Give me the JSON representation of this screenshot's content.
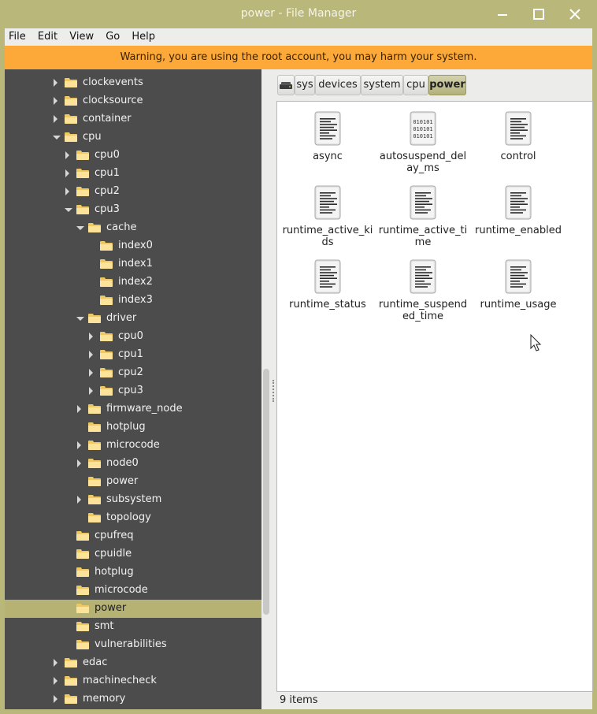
{
  "window": {
    "title": "power - File Manager",
    "controls": [
      "minimize-icon",
      "maximize-icon",
      "close-icon"
    ]
  },
  "menu": {
    "items": [
      "File",
      "Edit",
      "View",
      "Go",
      "Help"
    ]
  },
  "warning": {
    "text": "Warning, you are using the root account, you may harm your system."
  },
  "colors": {
    "titlebar": "#b9b77a",
    "warning_bg": "#fca93a",
    "sidebar_bg": "#4c4c4c",
    "selection": "#b5b273"
  },
  "tree": {
    "items": [
      {
        "label": "clockevents",
        "depth": 0,
        "expander": "closed"
      },
      {
        "label": "clocksource",
        "depth": 0,
        "expander": "closed"
      },
      {
        "label": "container",
        "depth": 0,
        "expander": "closed"
      },
      {
        "label": "cpu",
        "depth": 0,
        "expander": "open"
      },
      {
        "label": "cpu0",
        "depth": 1,
        "expander": "closed"
      },
      {
        "label": "cpu1",
        "depth": 1,
        "expander": "closed"
      },
      {
        "label": "cpu2",
        "depth": 1,
        "expander": "closed"
      },
      {
        "label": "cpu3",
        "depth": 1,
        "expander": "open"
      },
      {
        "label": "cache",
        "depth": 2,
        "expander": "open"
      },
      {
        "label": "index0",
        "depth": 3,
        "expander": "none"
      },
      {
        "label": "index1",
        "depth": 3,
        "expander": "none"
      },
      {
        "label": "index2",
        "depth": 3,
        "expander": "none"
      },
      {
        "label": "index3",
        "depth": 3,
        "expander": "none"
      },
      {
        "label": "driver",
        "depth": 2,
        "expander": "open"
      },
      {
        "label": "cpu0",
        "depth": 3,
        "expander": "closed"
      },
      {
        "label": "cpu1",
        "depth": 3,
        "expander": "closed"
      },
      {
        "label": "cpu2",
        "depth": 3,
        "expander": "closed"
      },
      {
        "label": "cpu3",
        "depth": 3,
        "expander": "closed"
      },
      {
        "label": "firmware_node",
        "depth": 2,
        "expander": "closed"
      },
      {
        "label": "hotplug",
        "depth": 2,
        "expander": "none"
      },
      {
        "label": "microcode",
        "depth": 2,
        "expander": "closed"
      },
      {
        "label": "node0",
        "depth": 2,
        "expander": "closed"
      },
      {
        "label": "power",
        "depth": 2,
        "expander": "none"
      },
      {
        "label": "subsystem",
        "depth": 2,
        "expander": "closed"
      },
      {
        "label": "topology",
        "depth": 2,
        "expander": "none"
      },
      {
        "label": "cpufreq",
        "depth": 1,
        "expander": "none"
      },
      {
        "label": "cpuidle",
        "depth": 1,
        "expander": "none"
      },
      {
        "label": "hotplug",
        "depth": 1,
        "expander": "none"
      },
      {
        "label": "microcode",
        "depth": 1,
        "expander": "none"
      },
      {
        "label": "power",
        "depth": 1,
        "expander": "none",
        "selected": true
      },
      {
        "label": "smt",
        "depth": 1,
        "expander": "none"
      },
      {
        "label": "vulnerabilities",
        "depth": 1,
        "expander": "none"
      },
      {
        "label": "edac",
        "depth": 0,
        "expander": "closed"
      },
      {
        "label": "machinecheck",
        "depth": 0,
        "expander": "closed"
      },
      {
        "label": "memory",
        "depth": 0,
        "expander": "closed"
      }
    ]
  },
  "breadcrumb": {
    "items": [
      {
        "label": "",
        "icon": "drive-icon"
      },
      {
        "label": "sys"
      },
      {
        "label": "devices"
      },
      {
        "label": "system"
      },
      {
        "label": "cpu"
      },
      {
        "label": "power",
        "active": true
      }
    ]
  },
  "files": {
    "items": [
      {
        "name": "async",
        "icon": "text-file-icon"
      },
      {
        "name": "autosuspend_delay_ms",
        "icon": "binary-file-icon"
      },
      {
        "name": "control",
        "icon": "text-file-icon"
      },
      {
        "name": "runtime_active_kids",
        "icon": "text-file-icon"
      },
      {
        "name": "runtime_active_time",
        "icon": "text-file-icon"
      },
      {
        "name": "runtime_enabled",
        "icon": "text-file-icon"
      },
      {
        "name": "runtime_status",
        "icon": "text-file-icon"
      },
      {
        "name": "runtime_suspended_time",
        "icon": "text-file-icon"
      },
      {
        "name": "runtime_usage",
        "icon": "text-file-icon"
      }
    ]
  },
  "status": {
    "text": "9 items"
  }
}
